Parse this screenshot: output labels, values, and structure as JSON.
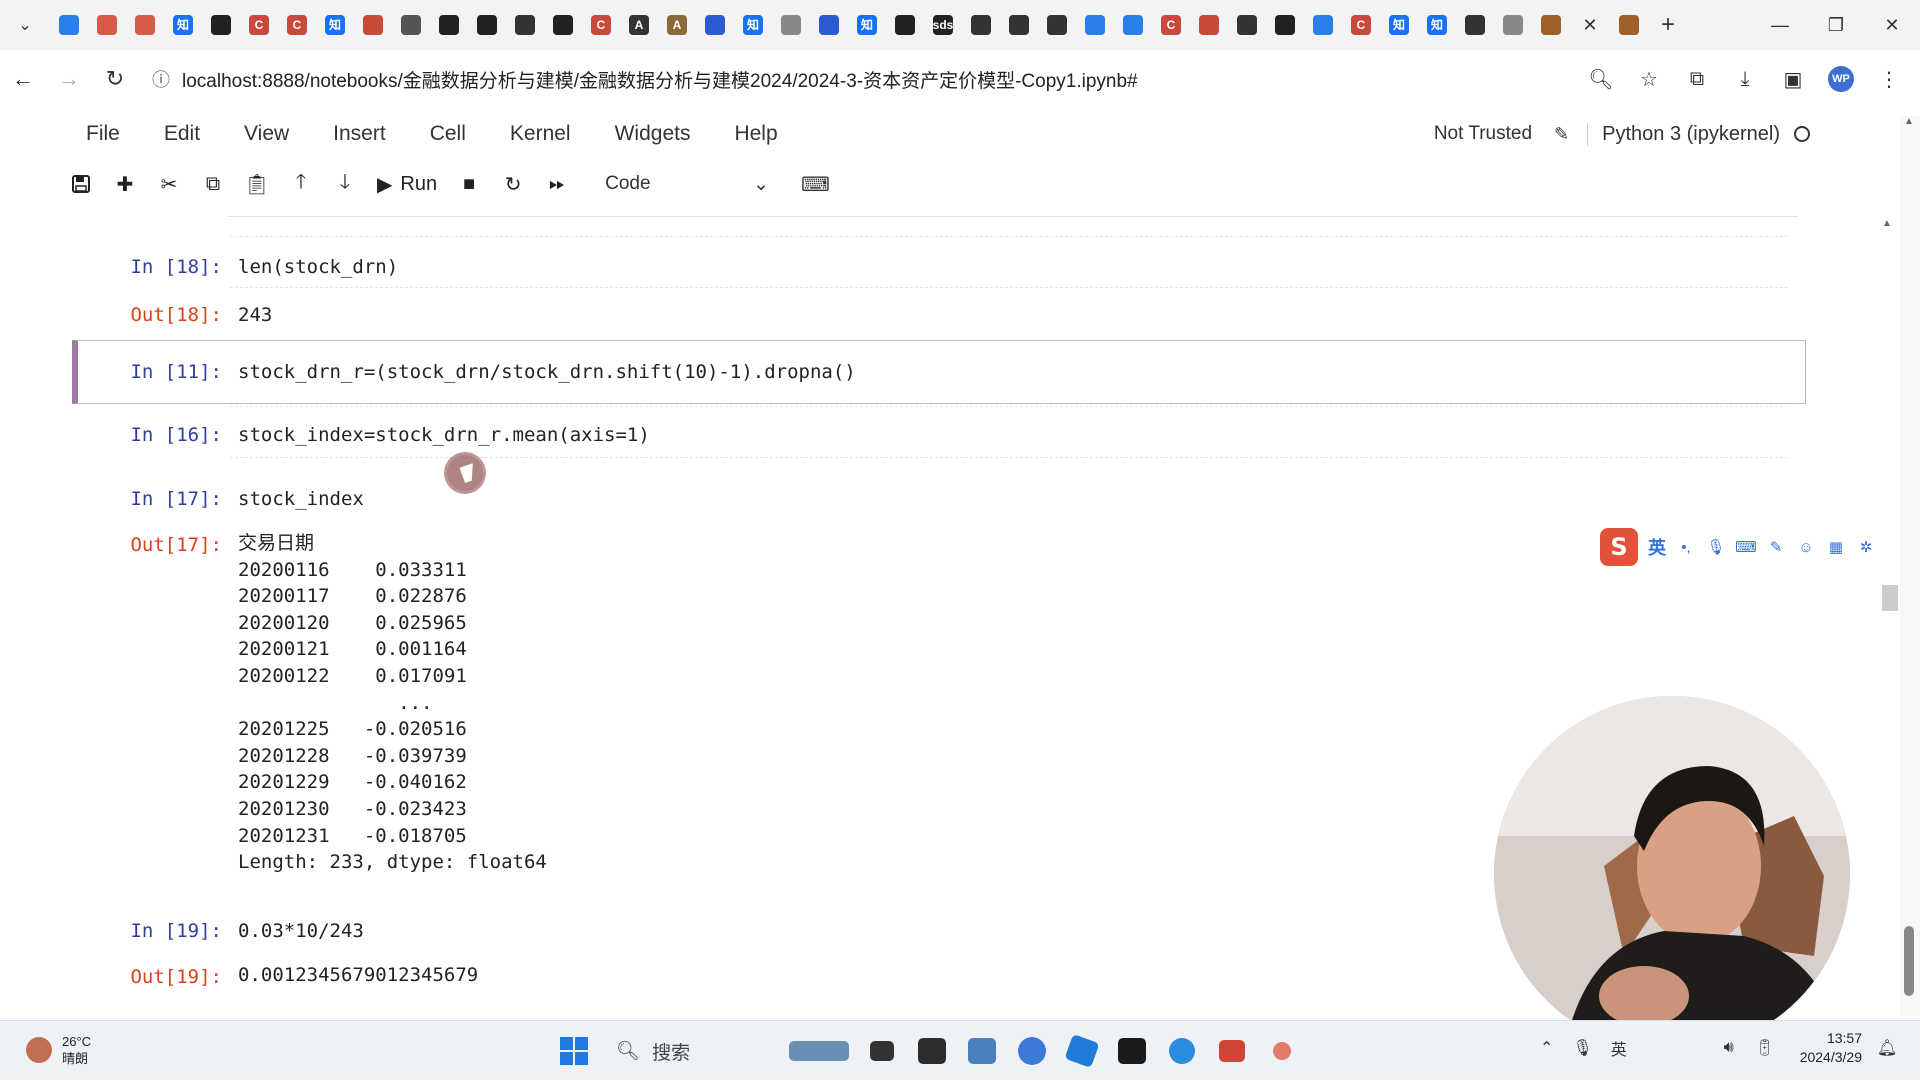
{
  "browser": {
    "tabs": [
      {
        "icon": "bilibili-icon",
        "label": "",
        "color": "#2a80eb"
      },
      {
        "icon": "record-icon",
        "label": "",
        "color": "#d65b4a"
      },
      {
        "icon": "play-icon",
        "label": "",
        "color": "#d65b4a"
      },
      {
        "icon": "zhihu-icon",
        "label": "知",
        "color": "#1772f6"
      },
      {
        "icon": "github-icon",
        "label": "",
        "color": "#222222"
      },
      {
        "icon": "csdn-icon",
        "label": "C",
        "color": "#c94a3a"
      },
      {
        "icon": "csdn-icon",
        "label": "C",
        "color": "#c94a3a"
      },
      {
        "icon": "zhihu-icon",
        "label": "知",
        "color": "#1772f6"
      },
      {
        "icon": "dot-icon",
        "label": "",
        "color": "#c94a3a"
      },
      {
        "icon": "globe-icon",
        "label": "",
        "color": "#555555"
      },
      {
        "icon": "video-icon",
        "label": "",
        "color": "#222222"
      },
      {
        "icon": "github-icon",
        "label": "",
        "color": "#222222"
      },
      {
        "icon": "terminal-icon",
        "label": "",
        "color": "#333333"
      },
      {
        "icon": "notion-icon",
        "label": "",
        "color": "#222222"
      },
      {
        "icon": "csdn-icon",
        "label": "C",
        "color": "#c94a3a"
      },
      {
        "icon": "font-icon",
        "label": "A",
        "color": "#333333"
      },
      {
        "icon": "font-icon",
        "label": "A",
        "color": "#8a6a3a"
      },
      {
        "icon": "baidu-icon",
        "label": "",
        "color": "#2d5bd4"
      },
      {
        "icon": "zhihu-icon",
        "label": "知",
        "color": "#1772f6"
      },
      {
        "icon": "image-icon",
        "label": "",
        "color": "#888888"
      },
      {
        "icon": "baidu-icon",
        "label": "",
        "color": "#2d5bd4"
      },
      {
        "icon": "zhihu-icon",
        "label": "知",
        "color": "#1772f6"
      },
      {
        "icon": "video-icon",
        "label": "",
        "color": "#222222"
      },
      {
        "icon": "sds-icon",
        "label": "sds",
        "color": "#222222"
      },
      {
        "icon": "link-icon",
        "label": "",
        "color": "#333333"
      },
      {
        "icon": "terminal-icon",
        "label": "",
        "color": "#333333"
      },
      {
        "icon": "terminal-icon",
        "label": "",
        "color": "#333333"
      },
      {
        "icon": "cloud-icon",
        "label": "",
        "color": "#2a80eb"
      },
      {
        "icon": "cloud-icon",
        "label": "",
        "color": "#2a80eb"
      },
      {
        "icon": "csdn-icon",
        "label": "C",
        "color": "#c94a3a"
      },
      {
        "icon": "runner-icon",
        "label": "",
        "color": "#c94a3a"
      },
      {
        "icon": "book-icon",
        "label": "",
        "color": "#333333"
      },
      {
        "icon": "video-icon",
        "label": "",
        "color": "#222222"
      },
      {
        "icon": "wing-icon",
        "label": "",
        "color": "#2a80eb"
      },
      {
        "icon": "csdn-icon",
        "label": "C",
        "color": "#c94a3a"
      },
      {
        "icon": "zhihu-icon",
        "label": "知",
        "color": "#1772f6"
      },
      {
        "icon": "zhihu-icon",
        "label": "知",
        "color": "#1772f6"
      },
      {
        "icon": "book-icon",
        "label": "",
        "color": "#333333"
      },
      {
        "icon": "loading-icon",
        "label": "",
        "color": "#888888"
      },
      {
        "icon": "doc-icon",
        "label": "",
        "color": "#a0602a"
      }
    ],
    "active_tab": {
      "icon": "doc-icon",
      "color": "#a0602a"
    },
    "url": "localhost:8888/notebooks/金融数据分析与建模/金融数据分析与建模2024/2024-3-资本资产定价模型-Copy1.ipynb#",
    "profile_initials": "WP"
  },
  "jupyter": {
    "menu": [
      "File",
      "Edit",
      "View",
      "Insert",
      "Cell",
      "Kernel",
      "Widgets",
      "Help"
    ],
    "trust_status": "Not Trusted",
    "kernel": "Python 3 (ipykernel)",
    "toolbar": {
      "run_label": "Run",
      "cell_type": "Code"
    },
    "cells": [
      {
        "in_prompt": "In  [18]:",
        "code": "len(stock_drn)",
        "out_prompt": "Out[18]:",
        "output": "243"
      },
      {
        "in_prompt": "In  [11]:",
        "code": "stock_drn_r=(stock_drn/stock_drn.shift(10)-1).dropna()",
        "out_prompt": "",
        "output": ""
      },
      {
        "in_prompt": "In  [16]:",
        "code": "stock_index=stock_drn_r.mean(axis=1)",
        "out_prompt": "",
        "output": ""
      },
      {
        "in_prompt": "In  [17]:",
        "code": "stock_index",
        "out_prompt": "Out[17]:",
        "output": "交易日期\n20200116    0.033311\n20200117    0.022876\n20200120    0.025965\n20200121    0.001164\n20200122    0.017091\n              ...   \n20201225   -0.020516\n20201228   -0.039739\n20201229   -0.040162\n20201230   -0.023423\n20201231   -0.018705\nLength: 233, dtype: float64"
      },
      {
        "in_prompt": "In  [19]:",
        "code": "0.03*10/243",
        "out_prompt": "Out[19]:",
        "output": "0.0012345679012345679"
      }
    ]
  },
  "ime": {
    "lang": "英"
  },
  "taskbar": {
    "weather_temp": "26°C",
    "weather_desc": "晴朗",
    "search_placeholder": "搜索",
    "time": "13:57",
    "date": "2024/3/29"
  }
}
